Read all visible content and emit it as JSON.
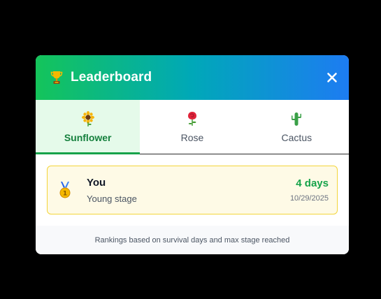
{
  "header": {
    "title": "Leaderboard",
    "title_icon": "trophy-icon",
    "close_icon": "close-icon"
  },
  "tabs": [
    {
      "label": "Sunflower",
      "icon": "sunflower-icon",
      "active": true
    },
    {
      "label": "Rose",
      "icon": "rose-icon",
      "active": false
    },
    {
      "label": "Cactus",
      "icon": "cactus-icon",
      "active": false
    }
  ],
  "entries": [
    {
      "rank_icon": "first-place-medal-icon",
      "name": "You",
      "stage": "Young stage",
      "days": "4 days",
      "date": "10/29/2025"
    }
  ],
  "footer": {
    "note": "Rankings based on survival days and max stage reached"
  },
  "colors": {
    "accent_green": "#16a34a",
    "gradient_start": "#14c45a",
    "gradient_end": "#1d7cf2",
    "highlight_border": "#f3d53a"
  }
}
